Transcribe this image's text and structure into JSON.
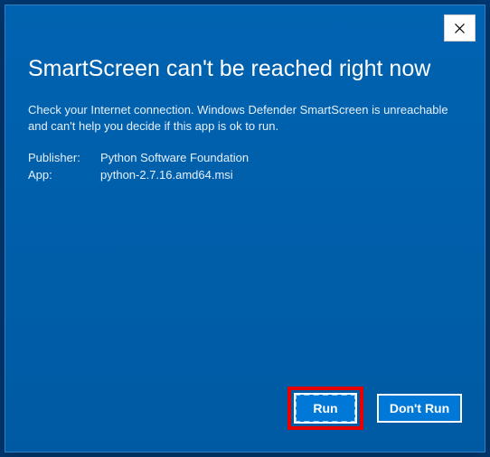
{
  "dialog": {
    "title": "SmartScreen can't be reached right now",
    "message": "Check your Internet connection. Windows Defender SmartScreen is unreachable and can't help you decide if this app is ok to run.",
    "publisher_label": "Publisher:",
    "publisher_value": "Python Software Foundation",
    "app_label": "App:",
    "app_value": "python-2.7.16.amd64.msi"
  },
  "buttons": {
    "run": "Run",
    "dont_run": "Don't Run"
  }
}
